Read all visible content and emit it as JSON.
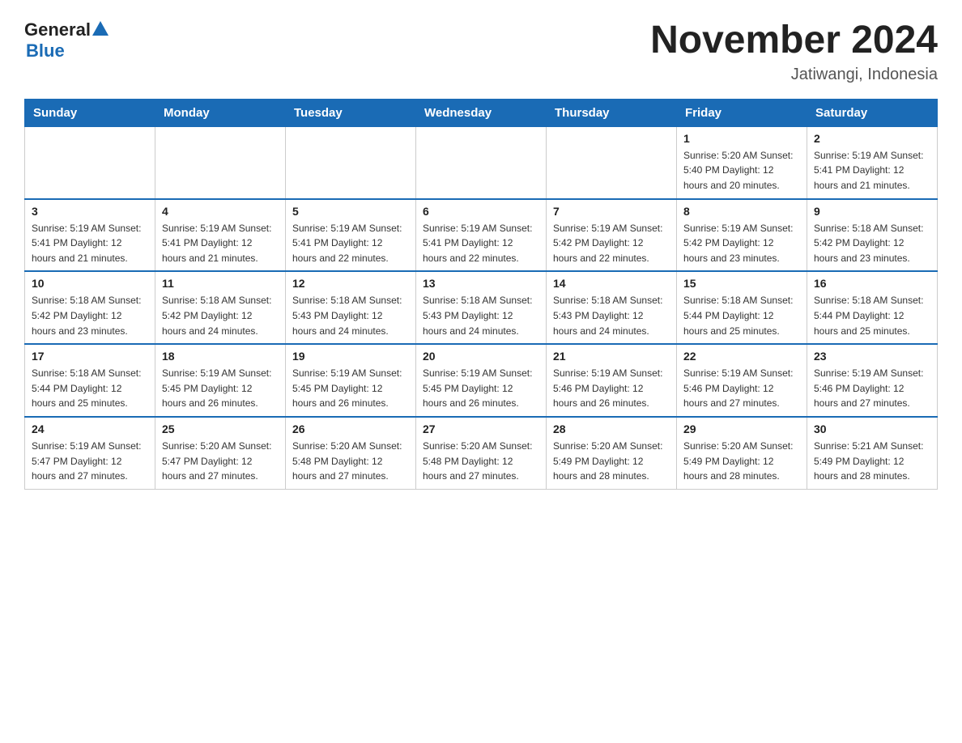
{
  "header": {
    "logo_general": "General",
    "logo_blue": "Blue",
    "title": "November 2024",
    "subtitle": "Jatiwangi, Indonesia"
  },
  "weekdays": [
    "Sunday",
    "Monday",
    "Tuesday",
    "Wednesday",
    "Thursday",
    "Friday",
    "Saturday"
  ],
  "weeks": [
    [
      {
        "day": "",
        "info": ""
      },
      {
        "day": "",
        "info": ""
      },
      {
        "day": "",
        "info": ""
      },
      {
        "day": "",
        "info": ""
      },
      {
        "day": "",
        "info": ""
      },
      {
        "day": "1",
        "info": "Sunrise: 5:20 AM\nSunset: 5:40 PM\nDaylight: 12 hours\nand 20 minutes."
      },
      {
        "day": "2",
        "info": "Sunrise: 5:19 AM\nSunset: 5:41 PM\nDaylight: 12 hours\nand 21 minutes."
      }
    ],
    [
      {
        "day": "3",
        "info": "Sunrise: 5:19 AM\nSunset: 5:41 PM\nDaylight: 12 hours\nand 21 minutes."
      },
      {
        "day": "4",
        "info": "Sunrise: 5:19 AM\nSunset: 5:41 PM\nDaylight: 12 hours\nand 21 minutes."
      },
      {
        "day": "5",
        "info": "Sunrise: 5:19 AM\nSunset: 5:41 PM\nDaylight: 12 hours\nand 22 minutes."
      },
      {
        "day": "6",
        "info": "Sunrise: 5:19 AM\nSunset: 5:41 PM\nDaylight: 12 hours\nand 22 minutes."
      },
      {
        "day": "7",
        "info": "Sunrise: 5:19 AM\nSunset: 5:42 PM\nDaylight: 12 hours\nand 22 minutes."
      },
      {
        "day": "8",
        "info": "Sunrise: 5:19 AM\nSunset: 5:42 PM\nDaylight: 12 hours\nand 23 minutes."
      },
      {
        "day": "9",
        "info": "Sunrise: 5:18 AM\nSunset: 5:42 PM\nDaylight: 12 hours\nand 23 minutes."
      }
    ],
    [
      {
        "day": "10",
        "info": "Sunrise: 5:18 AM\nSunset: 5:42 PM\nDaylight: 12 hours\nand 23 minutes."
      },
      {
        "day": "11",
        "info": "Sunrise: 5:18 AM\nSunset: 5:42 PM\nDaylight: 12 hours\nand 24 minutes."
      },
      {
        "day": "12",
        "info": "Sunrise: 5:18 AM\nSunset: 5:43 PM\nDaylight: 12 hours\nand 24 minutes."
      },
      {
        "day": "13",
        "info": "Sunrise: 5:18 AM\nSunset: 5:43 PM\nDaylight: 12 hours\nand 24 minutes."
      },
      {
        "day": "14",
        "info": "Sunrise: 5:18 AM\nSunset: 5:43 PM\nDaylight: 12 hours\nand 24 minutes."
      },
      {
        "day": "15",
        "info": "Sunrise: 5:18 AM\nSunset: 5:44 PM\nDaylight: 12 hours\nand 25 minutes."
      },
      {
        "day": "16",
        "info": "Sunrise: 5:18 AM\nSunset: 5:44 PM\nDaylight: 12 hours\nand 25 minutes."
      }
    ],
    [
      {
        "day": "17",
        "info": "Sunrise: 5:18 AM\nSunset: 5:44 PM\nDaylight: 12 hours\nand 25 minutes."
      },
      {
        "day": "18",
        "info": "Sunrise: 5:19 AM\nSunset: 5:45 PM\nDaylight: 12 hours\nand 26 minutes."
      },
      {
        "day": "19",
        "info": "Sunrise: 5:19 AM\nSunset: 5:45 PM\nDaylight: 12 hours\nand 26 minutes."
      },
      {
        "day": "20",
        "info": "Sunrise: 5:19 AM\nSunset: 5:45 PM\nDaylight: 12 hours\nand 26 minutes."
      },
      {
        "day": "21",
        "info": "Sunrise: 5:19 AM\nSunset: 5:46 PM\nDaylight: 12 hours\nand 26 minutes."
      },
      {
        "day": "22",
        "info": "Sunrise: 5:19 AM\nSunset: 5:46 PM\nDaylight: 12 hours\nand 27 minutes."
      },
      {
        "day": "23",
        "info": "Sunrise: 5:19 AM\nSunset: 5:46 PM\nDaylight: 12 hours\nand 27 minutes."
      }
    ],
    [
      {
        "day": "24",
        "info": "Sunrise: 5:19 AM\nSunset: 5:47 PM\nDaylight: 12 hours\nand 27 minutes."
      },
      {
        "day": "25",
        "info": "Sunrise: 5:20 AM\nSunset: 5:47 PM\nDaylight: 12 hours\nand 27 minutes."
      },
      {
        "day": "26",
        "info": "Sunrise: 5:20 AM\nSunset: 5:48 PM\nDaylight: 12 hours\nand 27 minutes."
      },
      {
        "day": "27",
        "info": "Sunrise: 5:20 AM\nSunset: 5:48 PM\nDaylight: 12 hours\nand 27 minutes."
      },
      {
        "day": "28",
        "info": "Sunrise: 5:20 AM\nSunset: 5:49 PM\nDaylight: 12 hours\nand 28 minutes."
      },
      {
        "day": "29",
        "info": "Sunrise: 5:20 AM\nSunset: 5:49 PM\nDaylight: 12 hours\nand 28 minutes."
      },
      {
        "day": "30",
        "info": "Sunrise: 5:21 AM\nSunset: 5:49 PM\nDaylight: 12 hours\nand 28 minutes."
      }
    ]
  ]
}
